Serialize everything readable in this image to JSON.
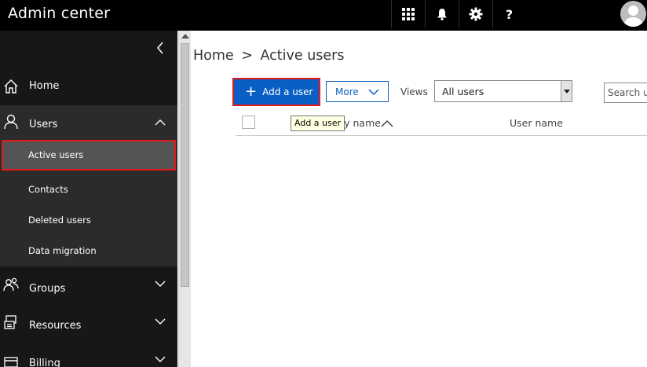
{
  "header": {
    "app_title": "Admin center",
    "icons": [
      "app-launcher-icon",
      "notifications-icon",
      "settings-icon",
      "help-icon"
    ],
    "help_label": "?"
  },
  "sidebar": {
    "items": [
      {
        "label": "Home",
        "icon": "home-icon"
      },
      {
        "label": "Users",
        "icon": "user-icon",
        "expanded": true,
        "children": [
          {
            "label": "Active users",
            "selected": true
          },
          {
            "label": "Contacts"
          },
          {
            "label": "Deleted users"
          },
          {
            "label": "Data migration"
          }
        ]
      },
      {
        "label": "Groups",
        "icon": "groups-icon"
      },
      {
        "label": "Resources",
        "icon": "resources-icon"
      },
      {
        "label": "Billing",
        "icon": "billing-icon"
      }
    ]
  },
  "main": {
    "breadcrumb": {
      "home": "Home",
      "separator": ">",
      "current": "Active users"
    },
    "toolbar": {
      "add_user_label": "Add a user",
      "more_label": "More",
      "views_label": "Views",
      "views_selected": "All users",
      "search_placeholder": "Search u"
    },
    "table": {
      "columns": [
        "Display name",
        "User name"
      ],
      "display_visible": "lay name"
    },
    "tooltip": "Add a user"
  },
  "colors": {
    "topbar": "#000000",
    "sidebar": "#171717",
    "accent": "#0a5fc4",
    "highlight": "#e21a1a"
  }
}
